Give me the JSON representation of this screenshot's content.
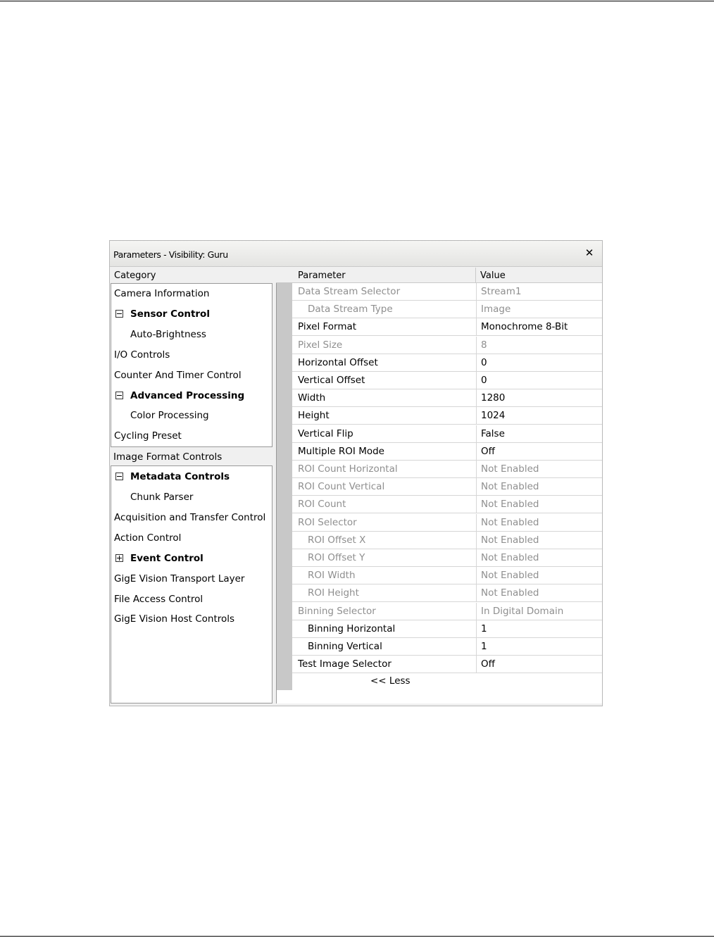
{
  "window": {
    "title": "Parameters - Visibility: Guru",
    "close_symbol": "✕"
  },
  "category": {
    "header": "Category",
    "items": [
      {
        "label": "Camera Information",
        "level": 0
      },
      {
        "label": "Sensor Control",
        "level": 0,
        "bold": true,
        "toggle": "collapse"
      },
      {
        "label": "Auto-Brightness",
        "level": 1
      },
      {
        "label": "I/O Controls",
        "level": 0
      },
      {
        "label": "Counter And Timer Control",
        "level": 0
      },
      {
        "label": "Advanced Processing",
        "level": 0,
        "bold": true,
        "toggle": "collapse"
      },
      {
        "label": "Color Processing",
        "level": 1
      },
      {
        "label": "Cycling Preset",
        "level": 0
      },
      {
        "label": "Image Format Controls",
        "level": 0,
        "selected": true
      },
      {
        "label": "Metadata Controls",
        "level": 0,
        "bold": true,
        "toggle": "collapse"
      },
      {
        "label": "Chunk Parser",
        "level": 1
      },
      {
        "label": "Acquisition and Transfer Control",
        "level": 0
      },
      {
        "label": "Action Control",
        "level": 0
      },
      {
        "label": "Event Control",
        "level": 0,
        "bold": true,
        "toggle": "expand"
      },
      {
        "label": "GigE Vision Transport Layer",
        "level": 0
      },
      {
        "label": "File Access Control",
        "level": 0
      },
      {
        "label": "GigE Vision Host Controls",
        "level": 0
      }
    ]
  },
  "params": {
    "header_parameter": "Parameter",
    "header_value": "Value",
    "rows": [
      {
        "name": "Data Stream Selector",
        "value": "Stream1",
        "enabled": false,
        "indent": false
      },
      {
        "name": "Data Stream Type",
        "value": "Image",
        "enabled": false,
        "indent": true
      },
      {
        "name": "Pixel Format",
        "value": "Monochrome 8-Bit",
        "enabled": true,
        "indent": false
      },
      {
        "name": "Pixel Size",
        "value": "8",
        "enabled": false,
        "indent": false
      },
      {
        "name": "Horizontal Offset",
        "value": "0",
        "enabled": true,
        "indent": false
      },
      {
        "name": "Vertical Offset",
        "value": "0",
        "enabled": true,
        "indent": false
      },
      {
        "name": "Width",
        "value": "1280",
        "enabled": true,
        "indent": false
      },
      {
        "name": "Height",
        "value": "1024",
        "enabled": true,
        "indent": false
      },
      {
        "name": "Vertical Flip",
        "value": "False",
        "enabled": true,
        "indent": false
      },
      {
        "name": "Multiple ROI Mode",
        "value": "Off",
        "enabled": true,
        "indent": false
      },
      {
        "name": "ROI Count Horizontal",
        "value": "Not Enabled",
        "enabled": false,
        "indent": false
      },
      {
        "name": "ROI Count Vertical",
        "value": "Not Enabled",
        "enabled": false,
        "indent": false
      },
      {
        "name": "ROI Count",
        "value": "Not Enabled",
        "enabled": false,
        "indent": false
      },
      {
        "name": "ROI Selector",
        "value": "Not Enabled",
        "enabled": false,
        "indent": false
      },
      {
        "name": "ROI Offset X",
        "value": "Not Enabled",
        "enabled": false,
        "indent": true
      },
      {
        "name": "ROI Offset Y",
        "value": "Not Enabled",
        "enabled": false,
        "indent": true
      },
      {
        "name": "ROI Width",
        "value": "Not Enabled",
        "enabled": false,
        "indent": true
      },
      {
        "name": "ROI Height",
        "value": "Not Enabled",
        "enabled": false,
        "indent": true
      },
      {
        "name": "Binning Selector",
        "value": "In Digital Domain",
        "enabled": false,
        "indent": false
      },
      {
        "name": "Binning Horizontal",
        "value": "1",
        "enabled": true,
        "indent": true
      },
      {
        "name": "Binning Vertical",
        "value": "1",
        "enabled": true,
        "indent": true
      },
      {
        "name": "Test Image Selector",
        "value": "Off",
        "enabled": true,
        "indent": false
      }
    ],
    "less_label": "<< Less"
  }
}
